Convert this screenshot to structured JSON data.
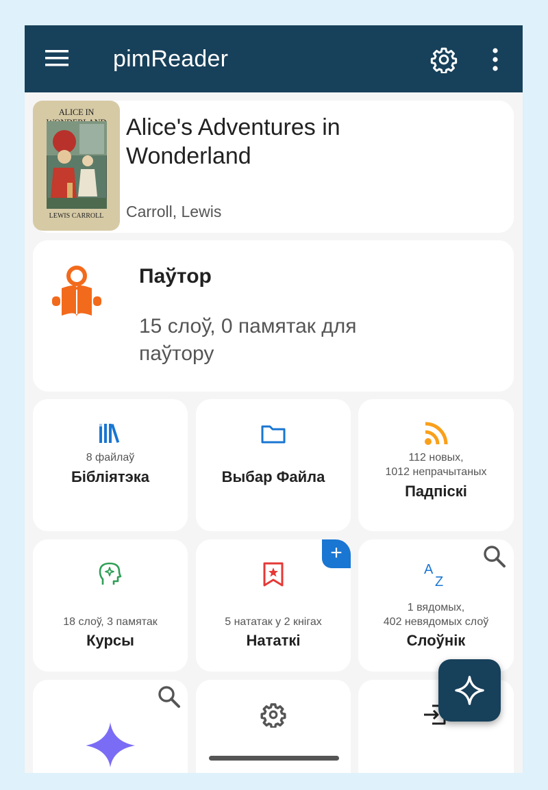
{
  "app": {
    "title": "pimReader"
  },
  "icons": {
    "menu": "menu-icon",
    "settings": "gear-icon",
    "more": "more-vert-icon",
    "fab": "sparkle-icon"
  },
  "colors": {
    "appbar": "#17405a",
    "accent_blue": "#1976d2",
    "orange": "#f26a1b",
    "green": "#2e9e55",
    "red": "#e53935",
    "rss": "#f9a01b",
    "purple": "#7b6cf6"
  },
  "current_book": {
    "title": "Alice's Adventures in Wonderland",
    "author": "Carroll, Lewis",
    "cover_title": "ALICE IN WONDERLAND",
    "cover_author": "LEWIS CARROLL"
  },
  "review": {
    "title": "Паўтор",
    "subtitle": "15 слоў, 0 памятак для паўтору"
  },
  "tiles": {
    "library": {
      "sub": "8 файлаў",
      "label": "Бібліятэка"
    },
    "file_picker": {
      "label": "Выбар Файла"
    },
    "subscriptions": {
      "sub1": "112 новых,",
      "sub2": "1012 непрачытаных",
      "label": "Падпіскі"
    },
    "courses": {
      "sub": "18 слоў, 3 памятак",
      "label": "Курсы"
    },
    "notes": {
      "sub": "5 нататак у 2 кнігах",
      "label": "Нататкі",
      "badge": "+"
    },
    "dictionary": {
      "sub1": "1 вядомых,",
      "sub2": "402 невядомых слоў",
      "label": "Слоўнік"
    }
  }
}
